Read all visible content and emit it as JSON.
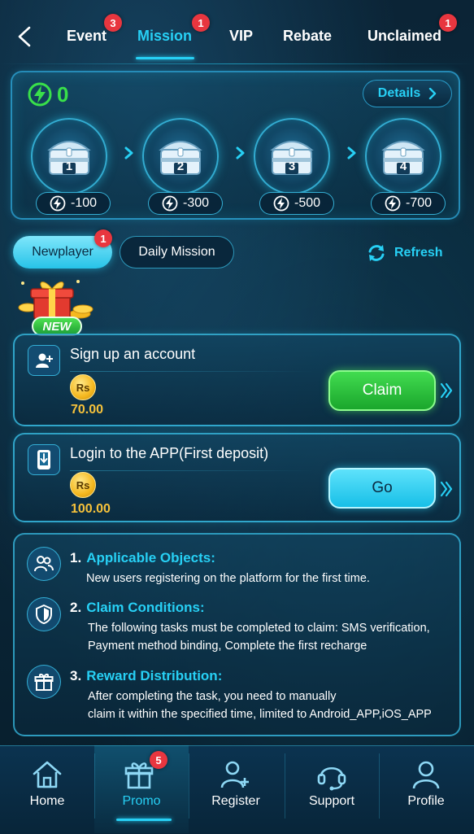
{
  "top_nav": {
    "tabs": [
      {
        "label": "Event",
        "badge": "3"
      },
      {
        "label": "Mission",
        "badge": "1",
        "active": true
      },
      {
        "label": "VIP"
      },
      {
        "label": "Rebate"
      },
      {
        "label": "Unclaimed",
        "badge": "1"
      }
    ]
  },
  "energy": {
    "value": "0"
  },
  "details_label": "Details",
  "chests": [
    {
      "num": "1",
      "cost": "-100"
    },
    {
      "num": "2",
      "cost": "-300"
    },
    {
      "num": "3",
      "cost": "-500"
    },
    {
      "num": "4",
      "cost": "-700"
    }
  ],
  "mission_types": [
    {
      "label": "Newplayer",
      "badge": "1",
      "active": true
    },
    {
      "label": "Daily Mission"
    }
  ],
  "refresh_label": "Refresh",
  "new_label": "NEW",
  "tasks": [
    {
      "title": "Sign up an account",
      "currency": "Rs",
      "amount": "70.00",
      "action": "Claim",
      "icon": "add-user-icon"
    },
    {
      "title": "Login to the APP(First deposit)",
      "currency": "Rs",
      "amount": "100.00",
      "action": "Go",
      "icon": "download-phone-icon"
    }
  ],
  "info": [
    {
      "num": "1.",
      "title": "Applicable Objects:",
      "lines": [
        "New users registering on the platform for the first time."
      ],
      "icon": "users-icon"
    },
    {
      "num": "2.",
      "title": "Claim Conditions:",
      "lines": [
        "The following tasks must be completed to claim: SMS verification,",
        "Payment method binding, Complete the first recharge"
      ],
      "icon": "shield-icon"
    },
    {
      "num": "3.",
      "title": "Reward Distribution:",
      "lines": [
        "After completing the task, you need to manually",
        "claim it within the specified time, limited to Android_APP,iOS_APP"
      ],
      "icon": "gift-icon"
    }
  ],
  "bottom_nav": [
    {
      "label": "Home",
      "icon": "home-icon"
    },
    {
      "label": "Promo",
      "badge": "5",
      "icon": "gift-icon",
      "active": true
    },
    {
      "label": "Register",
      "icon": "add-user-icon"
    },
    {
      "label": "Support",
      "icon": "headset-icon"
    },
    {
      "label": "Profile",
      "icon": "user-icon"
    }
  ],
  "colors": {
    "accent": "#27d0f5",
    "green": "#39e04a",
    "gold": "#f6c23b",
    "badge": "#e8363f"
  }
}
